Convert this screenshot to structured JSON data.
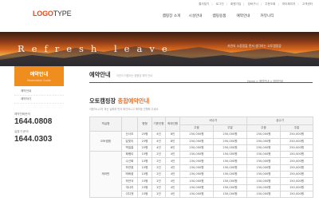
{
  "top_links": [
    "즐겨찾기",
    "로그인",
    "회원가입",
    "장바구니",
    "주문조회",
    "마이페이지",
    "고객센터"
  ],
  "logo": {
    "part1": "LOGO",
    "part2": "TYPE"
  },
  "gnb": [
    "캠핑장 소개",
    "시설안내",
    "캠핑용품",
    "예약안내",
    "커뮤니티"
  ],
  "hero": {
    "title": "Refresh leave",
    "subtitle": "자연의 소중함을 먼저 생각하는 오토캠핑장"
  },
  "lnb": {
    "title": "예약안내",
    "subtitle": "Reservation Guide",
    "items": [
      "예약안내",
      "예약하기"
    ]
  },
  "contacts": [
    {
      "label": "예약전화문의",
      "number": "1644.0808"
    },
    {
      "label": "길찾기 문의",
      "number": "1644.0303"
    }
  ],
  "page": {
    "title": "예약안내",
    "description": "자연이 어울리는 캠핑장 예약 안내",
    "breadcrumb": "Home > 예약안내 > 예약안내"
  },
  "section": {
    "title_prefix": "오토캠핑장 ",
    "title_highlight": "종합예약안내",
    "description": "이용하시고자 하는 날짜를 먼저 확인하시고 예약을 진행해 주세요."
  },
  "table": {
    "headers": {
      "type": "객실명",
      "size": "평형",
      "base": "기준인원",
      "max": "최대인원",
      "off_season": "비수기",
      "peak_season": "성수기",
      "weekday": "주중",
      "weekend": "주말"
    },
    "groups": [
      {
        "name": "오토캠핑",
        "rows": [
          {
            "name": "산사조",
            "size": "25평",
            "base": "4인",
            "max": "8인",
            "off_weekday": "250,000원",
            "off_weekend": "250,000원",
            "peak_weekday": "250,000원",
            "peak_weekend": "250,000원"
          },
          {
            "name": "달맞이",
            "size": "25평",
            "base": "4인",
            "max": "8인",
            "off_weekday": "250,000원",
            "off_weekend": "250,000원",
            "peak_weekday": "250,000원",
            "peak_weekend": "250,000원"
          },
          {
            "name": "백일홍",
            "size": "25평",
            "base": "4인",
            "max": "8인",
            "off_weekday": "250,000원",
            "off_weekend": "250,000원",
            "peak_weekday": "250,000원",
            "peak_weekend": "250,000원"
          }
        ]
      },
      {
        "name": "캐라반",
        "rows": [
          {
            "name": "패랭이",
            "size": "15평",
            "base": "2인",
            "max": "4인",
            "off_weekday": "150,000원",
            "off_weekend": "150,000원",
            "peak_weekday": "150,000원",
            "peak_weekend": "150,000원"
          },
          {
            "name": "수선화",
            "size": "15평",
            "base": "2인",
            "max": "4인",
            "off_weekday": "150,000원",
            "off_weekend": "150,000원",
            "peak_weekday": "150,000원",
            "peak_weekend": "150,000원"
          },
          {
            "name": "하얀꽃",
            "size": "15평",
            "base": "2인",
            "max": "4인",
            "off_weekday": "150,000원",
            "off_weekend": "150,000원",
            "peak_weekday": "150,000원",
            "peak_weekend": "150,000원"
          },
          {
            "name": "매화꽃",
            "size": "15평",
            "base": "2인",
            "max": "4인",
            "off_weekday": "150,000원",
            "off_weekend": "150,000원",
            "peak_weekday": "150,000원",
            "peak_weekend": "150,000원"
          },
          {
            "name": "하얀국",
            "size": "15평",
            "base": "2인",
            "max": "4인",
            "off_weekday": "150,000원",
            "off_weekend": "150,000원",
            "peak_weekday": "150,000원",
            "peak_weekend": "150,000원"
          },
          {
            "name": "개나리",
            "size": "15평",
            "base": "2인",
            "max": "4인",
            "off_weekday": "150,000원",
            "off_weekend": "150,000원",
            "peak_weekday": "150,000원",
            "peak_weekend": "150,000원"
          },
          {
            "name": "이디엔",
            "size": "15평",
            "base": "2인",
            "max": "4인",
            "off_weekday": "150,000원",
            "off_weekend": "150,000원",
            "peak_weekday": "150,000원",
            "peak_weekend": "150,000원"
          }
        ]
      }
    ]
  },
  "colors": {
    "accent": "#f08d1f",
    "logo_accent": "#e84a1f",
    "highlight": "#e8742a"
  }
}
